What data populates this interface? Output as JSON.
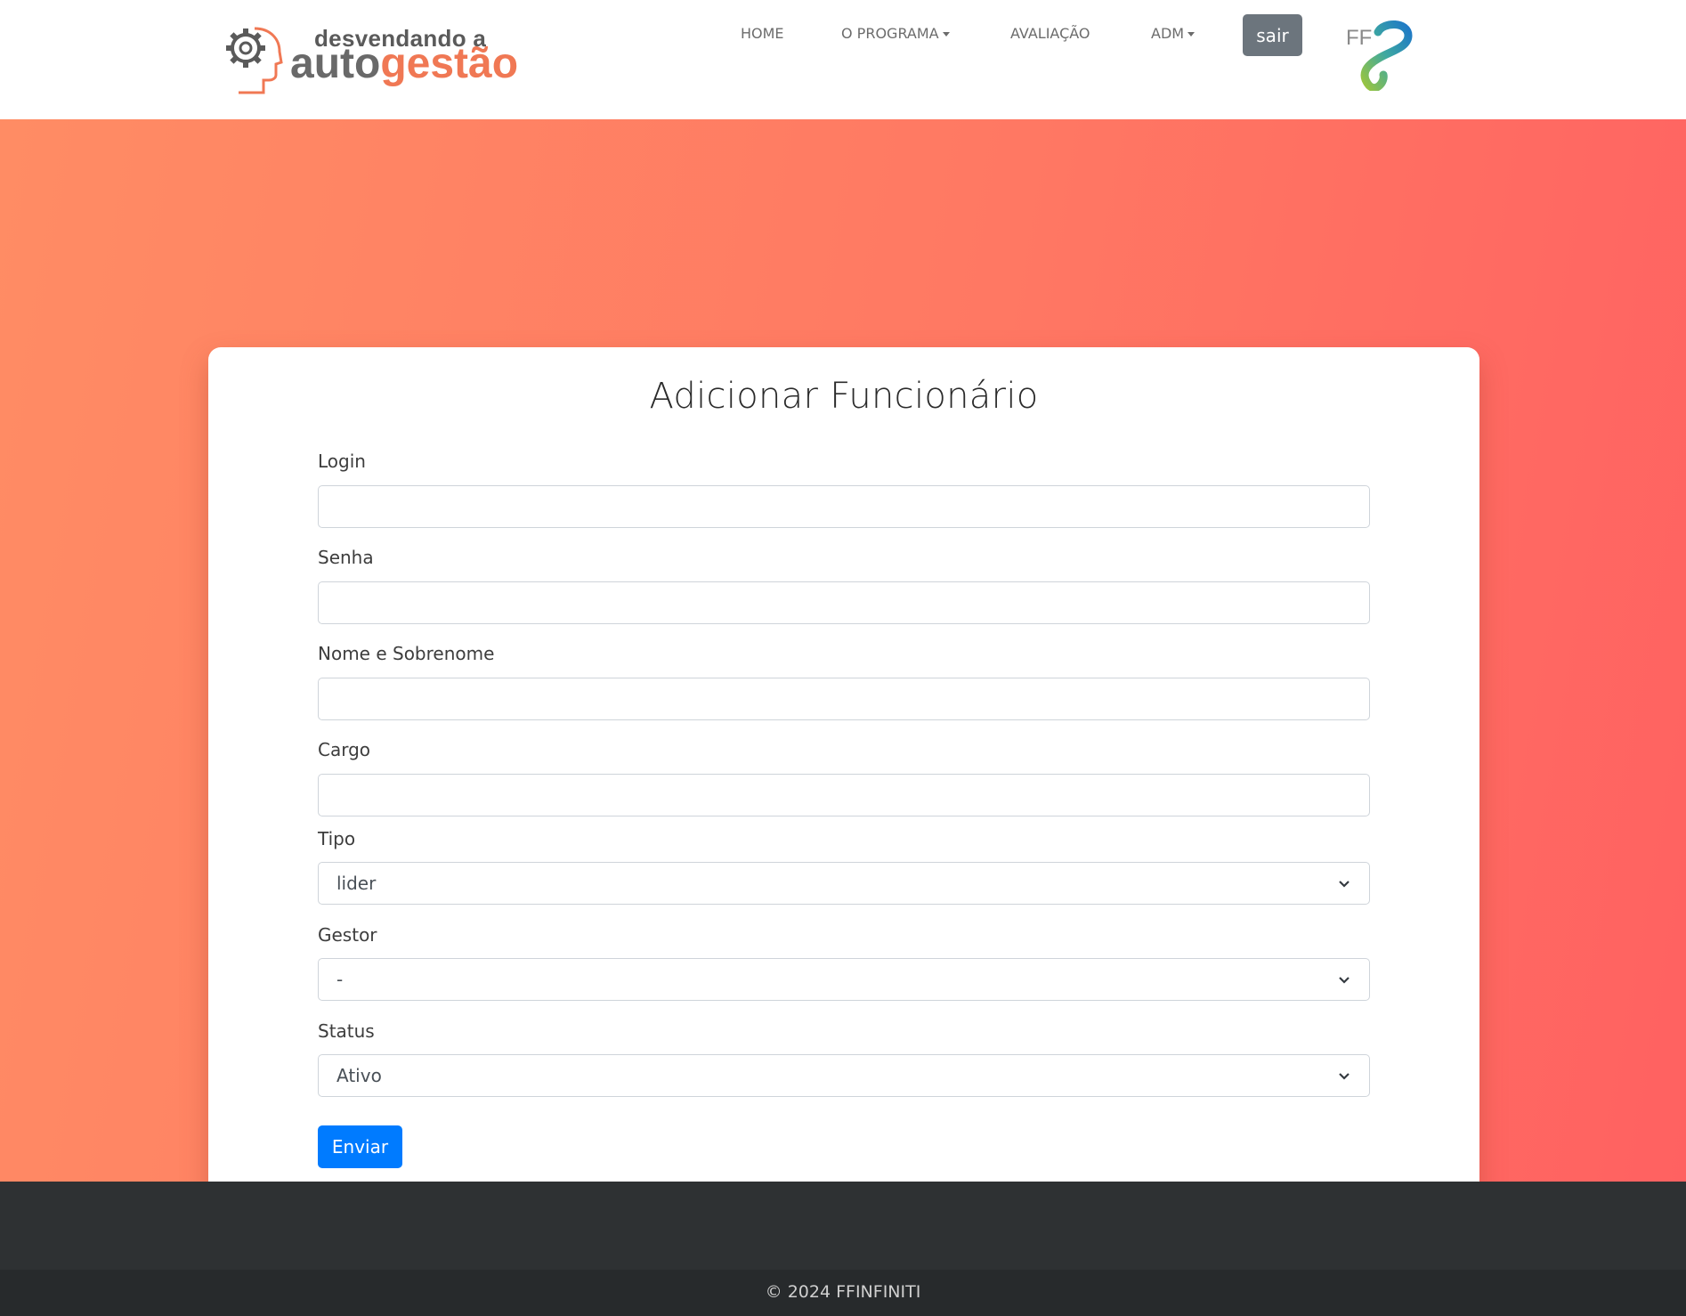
{
  "brand": {
    "logo_line1": "desvendando a",
    "logo_auto": "auto",
    "logo_gestao": "gestão",
    "partner_logo_text": "FF",
    "colors": {
      "accent": "#f07854",
      "gray": "#696969"
    }
  },
  "nav": {
    "items": [
      {
        "label": "HOME",
        "dropdown": false
      },
      {
        "label": "O PROGRAMA",
        "dropdown": true
      },
      {
        "label": "AVALIAÇÃO",
        "dropdown": false
      },
      {
        "label": "ADM",
        "dropdown": true
      }
    ],
    "logout_label": "sair"
  },
  "form": {
    "title": "Adicionar Funcionário",
    "fields": [
      {
        "label": "Login",
        "type": "text",
        "value": ""
      },
      {
        "label": "Senha",
        "type": "password",
        "value": ""
      },
      {
        "label": "Nome e Sobrenome",
        "type": "text",
        "value": ""
      },
      {
        "label": "Cargo",
        "type": "text",
        "value": ""
      },
      {
        "label": "Tipo",
        "type": "select",
        "value": "lider"
      },
      {
        "label": "Gestor",
        "type": "select",
        "value": "-"
      },
      {
        "label": "Status",
        "type": "select",
        "value": "Ativo"
      }
    ],
    "submit_label": "Enviar"
  },
  "footer": {
    "copyright": "© 2024 FFINFINITI"
  },
  "colors": {
    "gradient_start": "#ff8c64",
    "gradient_end": "#ff6161",
    "primary_button": "#007bff",
    "secondary_button": "#6c757d",
    "footer": "#2e3133"
  }
}
